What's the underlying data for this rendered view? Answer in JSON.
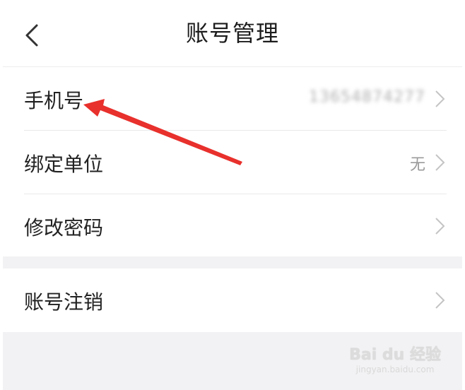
{
  "header": {
    "title": "账号管理",
    "back_icon": "chevron-left-icon"
  },
  "account_group": [
    {
      "label": "手机号",
      "value": "13654874277"
    },
    {
      "label": "绑定单位",
      "value": "无"
    },
    {
      "label": "修改密码",
      "value": ""
    }
  ],
  "danger_group": [
    {
      "label": "账号注销",
      "value": ""
    }
  ],
  "watermark": {
    "logo": "Bai du 经验",
    "sub": "jingyan.baidu.com"
  },
  "colors": {
    "annotation_arrow": "#e8302c",
    "page_bg": "#f2f2f4"
  }
}
